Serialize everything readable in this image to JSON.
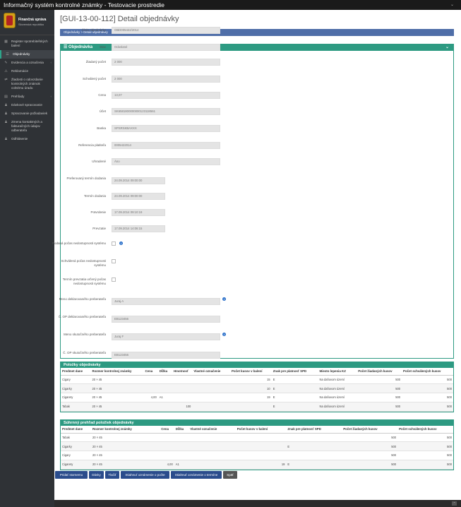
{
  "app_title": "Informačný systém kontrolné známky - Testovacie prostredie",
  "logo": {
    "line1": "Finančná správa",
    "line2": "Slovenská republika"
  },
  "sidebar": {
    "items": [
      {
        "icon": "grid-icon",
        "label": "Register spotrebiteľských balení"
      },
      {
        "icon": "list-icon",
        "label": "Objednávky"
      },
      {
        "icon": "edit-icon",
        "label": "Evidencia a označenia"
      },
      {
        "icon": "warning-icon",
        "label": "Reklamácie"
      },
      {
        "icon": "link-icon",
        "label": "Žiadosti o odovzdanie kontrolných známok colnému úradu"
      },
      {
        "icon": "chart-icon",
        "label": "Prehľady"
      },
      {
        "icon": "user-icon",
        "label": "Dávkové spracovanie"
      },
      {
        "icon": "user-icon",
        "label": "Spracovanie požiadaviek"
      },
      {
        "icon": "user-icon",
        "label": "Zmena kontaktných a fakturačných údajov odberateľa"
      },
      {
        "icon": "user-icon",
        "label": "Odhlásenie"
      }
    ]
  },
  "page": {
    "title": "[GUI-13-00-112] Detail objednávky",
    "breadcrumb": "Objednávky > Detail objednávky",
    "panel_title": "Objednávka"
  },
  "form": [
    {
      "label": "Číslo objednávky",
      "value": "OBD005422/2014"
    },
    {
      "label": "Stav",
      "value": "Odoslané"
    },
    {
      "label": "Žiadaný počet",
      "value": "2 000"
    },
    {
      "label": "Schválený počet",
      "value": "2 000"
    },
    {
      "label": "Cena",
      "value": "13,07"
    },
    {
      "label": "Účet",
      "value": "SK6581800000000123118561"
    },
    {
      "label": "Banka",
      "value": "SPSRSKBAXXX"
    },
    {
      "label": "Referencia platiteľa",
      "value": "0005422014"
    },
    {
      "label": "Uhradené",
      "value": "Áno"
    },
    {
      "label": "Preferovaný termín dodania",
      "value": "24.09.2014 09:00:00"
    },
    {
      "label": "Termín dodania",
      "value": "24.09.2014 09:00:00"
    },
    {
      "label": "Potvrdenie",
      "value": "17.09.2014 09:10:19"
    },
    {
      "label": "Prevzatie",
      "value": "17.09.2014 14:06:15"
    },
    {
      "label": "Podaná počas nedostupnosti systému",
      "value": ""
    },
    {
      "label": "Schválená počas nedostupnosti systému",
      "value": ""
    },
    {
      "label": "Termín prevzatia určený počas nedostupnosti systému",
      "value": ""
    },
    {
      "label": "Meno deklarovaného preberateľa",
      "value": "Juraj A"
    },
    {
      "label": "Č. OP deklarovaného preberateľa",
      "value": "EB123456"
    },
    {
      "label": "Meno skutočného preberateľa",
      "value": "Juraj F"
    },
    {
      "label": "Č. OP skutočného preberateľa",
      "value": "EB123456"
    }
  ],
  "items_table": {
    "title": "Položky objednávky",
    "headers": [
      "Predmet dane",
      "Rozmer kontrolnej známky",
      "Cena",
      "Dĺžka",
      "Hmotnosť",
      "Vlastné označenie",
      "Počet kusov v balení",
      "Znak pre platnosť SPD",
      "Miesto lepenia KZ",
      "Počet žiadaných kusov",
      "Počet schválených kusov"
    ],
    "rows": [
      [
        "Cigary",
        "20 × 45",
        "",
        "",
        "",
        "",
        "15",
        "E",
        "Na daňovom území",
        "500",
        "500"
      ],
      [
        "Cigarky",
        "20 × 45",
        "",
        "",
        "",
        "",
        "10",
        "E",
        "Na daňovom území",
        "500",
        "500"
      ],
      [
        "Cigarety",
        "20 × 45",
        "4,00",
        "A1",
        "",
        "",
        "19",
        "E",
        "Na daňovom území",
        "500",
        "500"
      ],
      [
        "Tabak",
        "20 × 45",
        "",
        "",
        "100",
        "",
        "",
        "E",
        "Na daňovom území",
        "500",
        "500"
      ]
    ]
  },
  "summary_table": {
    "title": "Súhrnný prehľad položiek objednávky",
    "headers": [
      "Predmet dane",
      "Rozmer kontrolnej známky",
      "Cena",
      "Dĺžka",
      "Vlastné označenie",
      "Počet kusov v balení",
      "Znak pre platnosť SPD",
      "Počet žiadaných kusov",
      "Počet schválených kusov"
    ],
    "rows": [
      [
        "Tabak",
        "20 × 45",
        "",
        "",
        "",
        "",
        "",
        "500",
        "500"
      ],
      [
        "Cigarky",
        "20 × 45",
        "",
        "",
        "",
        "",
        "E",
        "500",
        "500"
      ],
      [
        "Cigary",
        "20 × 45",
        "",
        "",
        "",
        "",
        "",
        "500",
        "500"
      ],
      [
        "Cigarety",
        "20 × 45",
        "4,00",
        "A1",
        "",
        "19",
        "E",
        "500",
        "500"
      ]
    ]
  },
  "buttons": [
    "Pridať stornemu",
    "Dávky",
    "Tlačiť",
    "Stiahnuť oznámenie o počte",
    "Stiahnuť oznámenie o termíne",
    "Späť"
  ]
}
